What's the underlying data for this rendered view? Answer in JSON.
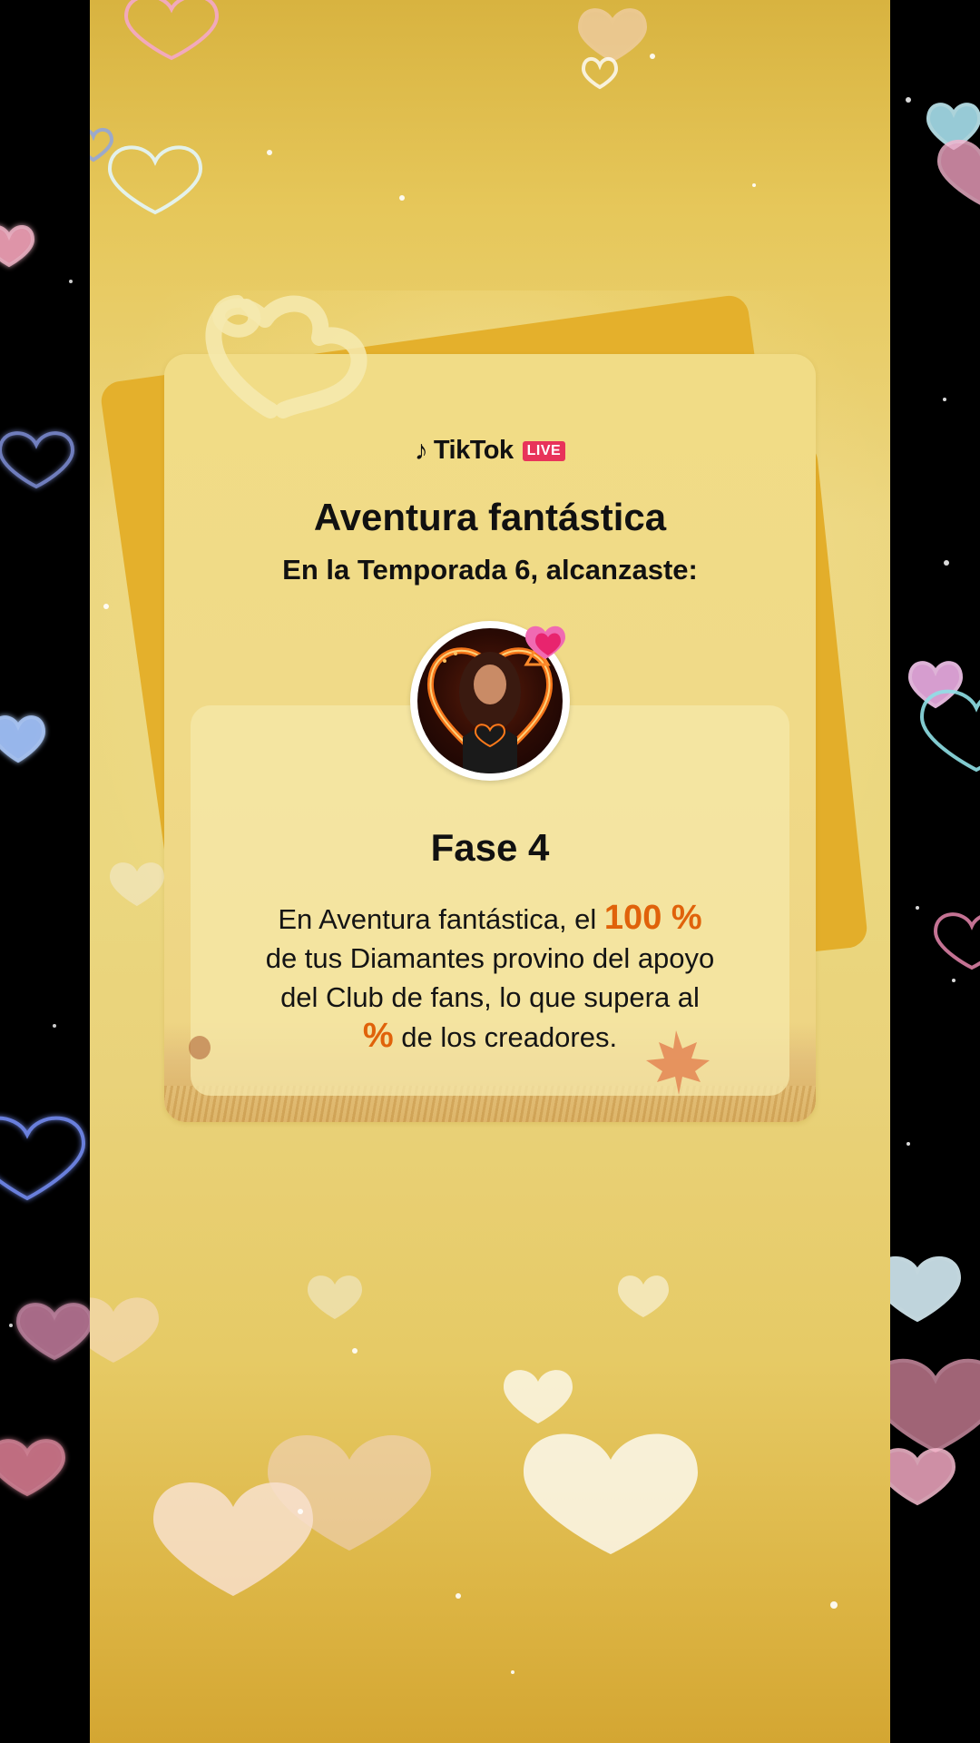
{
  "brand": {
    "logo_icon": "tiktok-note-icon",
    "name": "TikTok",
    "live_badge": "LIVE"
  },
  "card": {
    "title": "Aventura fantástica",
    "subtitle": "En la Temporada 6, alcanzaste:",
    "phase": "Fase 4",
    "body": {
      "line1_prefix": "En Aventura fantástica, el ",
      "line1_highlight": "100 %",
      "line2": "de tus Diamantes provino del apoyo",
      "line3": "del Club de fans, lo que supera al",
      "line4_highlight": "%",
      "line4_suffix": " de los creadores."
    }
  },
  "colors": {
    "accent": "#e0620a",
    "panel": "#ebd77f",
    "back_card": "#e4b02c",
    "live_badge": "#e8335a",
    "fan_badge": "#f0418a"
  }
}
